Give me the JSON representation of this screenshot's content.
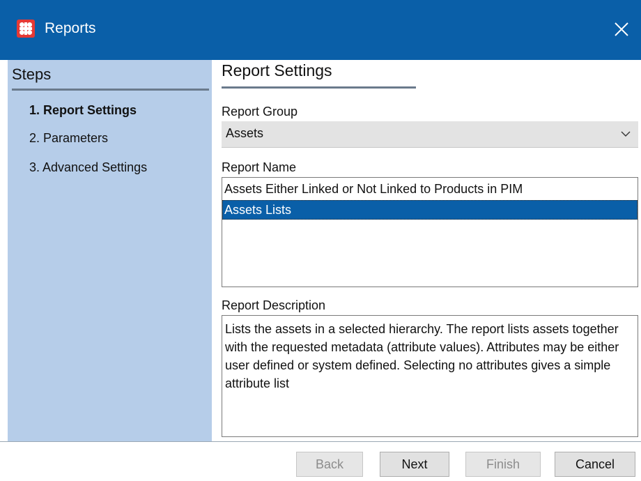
{
  "window": {
    "title": "Reports",
    "app_icon": "stibo-app-icon",
    "close_icon": "close-icon"
  },
  "steps": {
    "heading": "Steps",
    "items": [
      {
        "label": "1. Report Settings",
        "active": true
      },
      {
        "label": "2. Parameters",
        "active": false
      },
      {
        "label": "3. Advanced Settings",
        "active": false
      }
    ]
  },
  "content": {
    "heading": "Report Settings",
    "report_group": {
      "label": "Report Group",
      "value": "Assets"
    },
    "report_name": {
      "label": "Report Name",
      "items": [
        {
          "text": "Assets Either Linked or Not Linked to Products in PIM",
          "selected": false
        },
        {
          "text": "Assets Lists",
          "selected": true
        }
      ]
    },
    "report_description": {
      "label": "Report Description",
      "text": "Lists the assets in a selected hierarchy. The report lists assets together with the requested metadata (attribute values). Attributes may be either user defined or system defined. Selecting no attributes gives a simple attribute list"
    }
  },
  "footer": {
    "back": {
      "label": "Back",
      "enabled": false
    },
    "next": {
      "label": "Next",
      "enabled": true
    },
    "finish": {
      "label": "Finish",
      "enabled": false
    },
    "cancel": {
      "label": "Cancel",
      "enabled": true
    }
  },
  "colors": {
    "titlebar": "#0a5fa8",
    "steps_panel": "#b6cde9",
    "selection": "#0a5fa8"
  }
}
